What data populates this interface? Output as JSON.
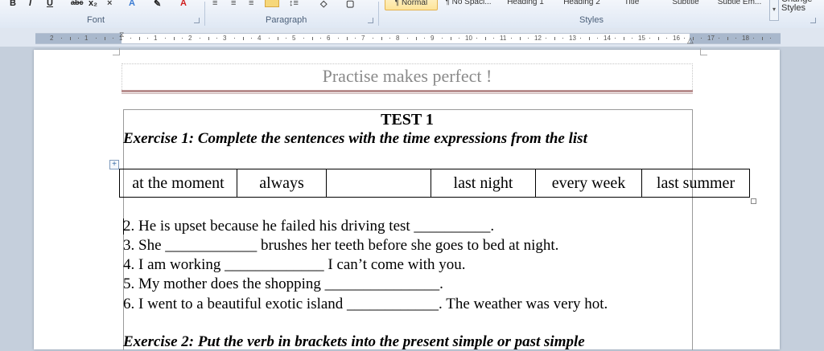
{
  "ribbon": {
    "font_group_label": "Font",
    "paragraph_group_label": "Paragraph",
    "styles_group_label": "Styles",
    "styles": [
      {
        "label": "¶ Normal",
        "selected": true
      },
      {
        "label": "¶ No Spaci...",
        "selected": false
      },
      {
        "label": "Heading 1",
        "selected": false
      },
      {
        "label": "Heading 2",
        "selected": false
      },
      {
        "label": "Title",
        "selected": false
      },
      {
        "label": "Subtitle",
        "selected": false
      },
      {
        "label": "Subtle Em...",
        "selected": false
      }
    ],
    "change_styles_label": "Change Styles",
    "font_glyphs": {
      "bold": "B",
      "italic": "I",
      "underline": "U",
      "strike": "abc",
      "subscript": "x₂",
      "font_color": "A"
    }
  },
  "ruler": {
    "numbers": [
      "2",
      "1",
      "1",
      "1",
      "2",
      "3",
      "4",
      "5",
      "6",
      "7",
      "8",
      "9",
      "10",
      "11",
      "12",
      "13",
      "14",
      "15",
      "16",
      "17",
      "18",
      "19"
    ]
  },
  "document": {
    "header_title": "Practise makes perfect !",
    "test_title": "TEST 1",
    "exercise1_heading": "Exercise 1: Complete the sentences with the time expressions from the list",
    "word_list": [
      "at the moment",
      "always",
      "",
      "last night",
      "every week",
      "last summer"
    ],
    "sentences": [
      "2. He is upset because he failed his driving test __________.",
      "3. She ____________ brushes her teeth before she goes to bed at night.",
      "4. I am working _____________ I can’t come with you.",
      "5. My mother does the shopping _______________.",
      "6. I went to a beautiful exotic island ____________. The weather was very hot."
    ],
    "exercise2_heading": "Exercise 2: Put the verb in brackets into the present simple or past simple"
  },
  "colors": {
    "ribbon_bg": "#e4ecf6",
    "header_text": "#8a8a8a",
    "header_rule": "#b88f8f",
    "workspace": "#c5cfdc"
  }
}
